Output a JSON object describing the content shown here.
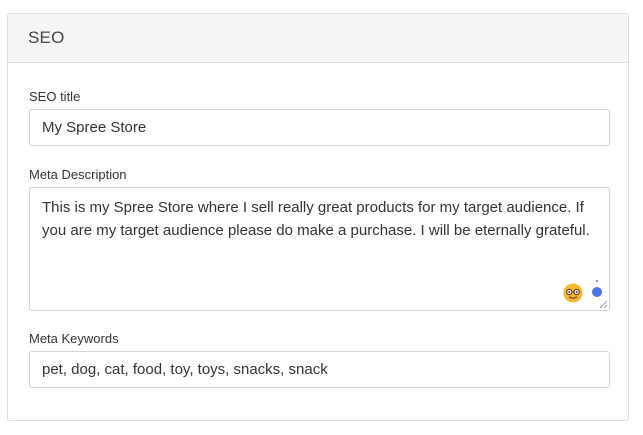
{
  "panel": {
    "title": "SEO"
  },
  "fields": {
    "seo_title": {
      "label": "SEO title",
      "value": "My Spree Store"
    },
    "meta_description": {
      "label": "Meta Description",
      "value": "This is my Spree Store where I sell really great products for my target audience. If you are my target audience please do make a purchase. I will be eternally grateful."
    },
    "meta_keywords": {
      "label": "Meta Keywords",
      "value": "pet, dog, cat, food, toy, toys, snacks, snack"
    }
  },
  "icons": {
    "emoji": "nerd-face-icon",
    "status": "blue-dot-icon"
  },
  "colors": {
    "dot": "#4a73e0",
    "emoji": "#f5b731",
    "border": "#cfd4d9",
    "header_bg": "#f5f5f5"
  }
}
